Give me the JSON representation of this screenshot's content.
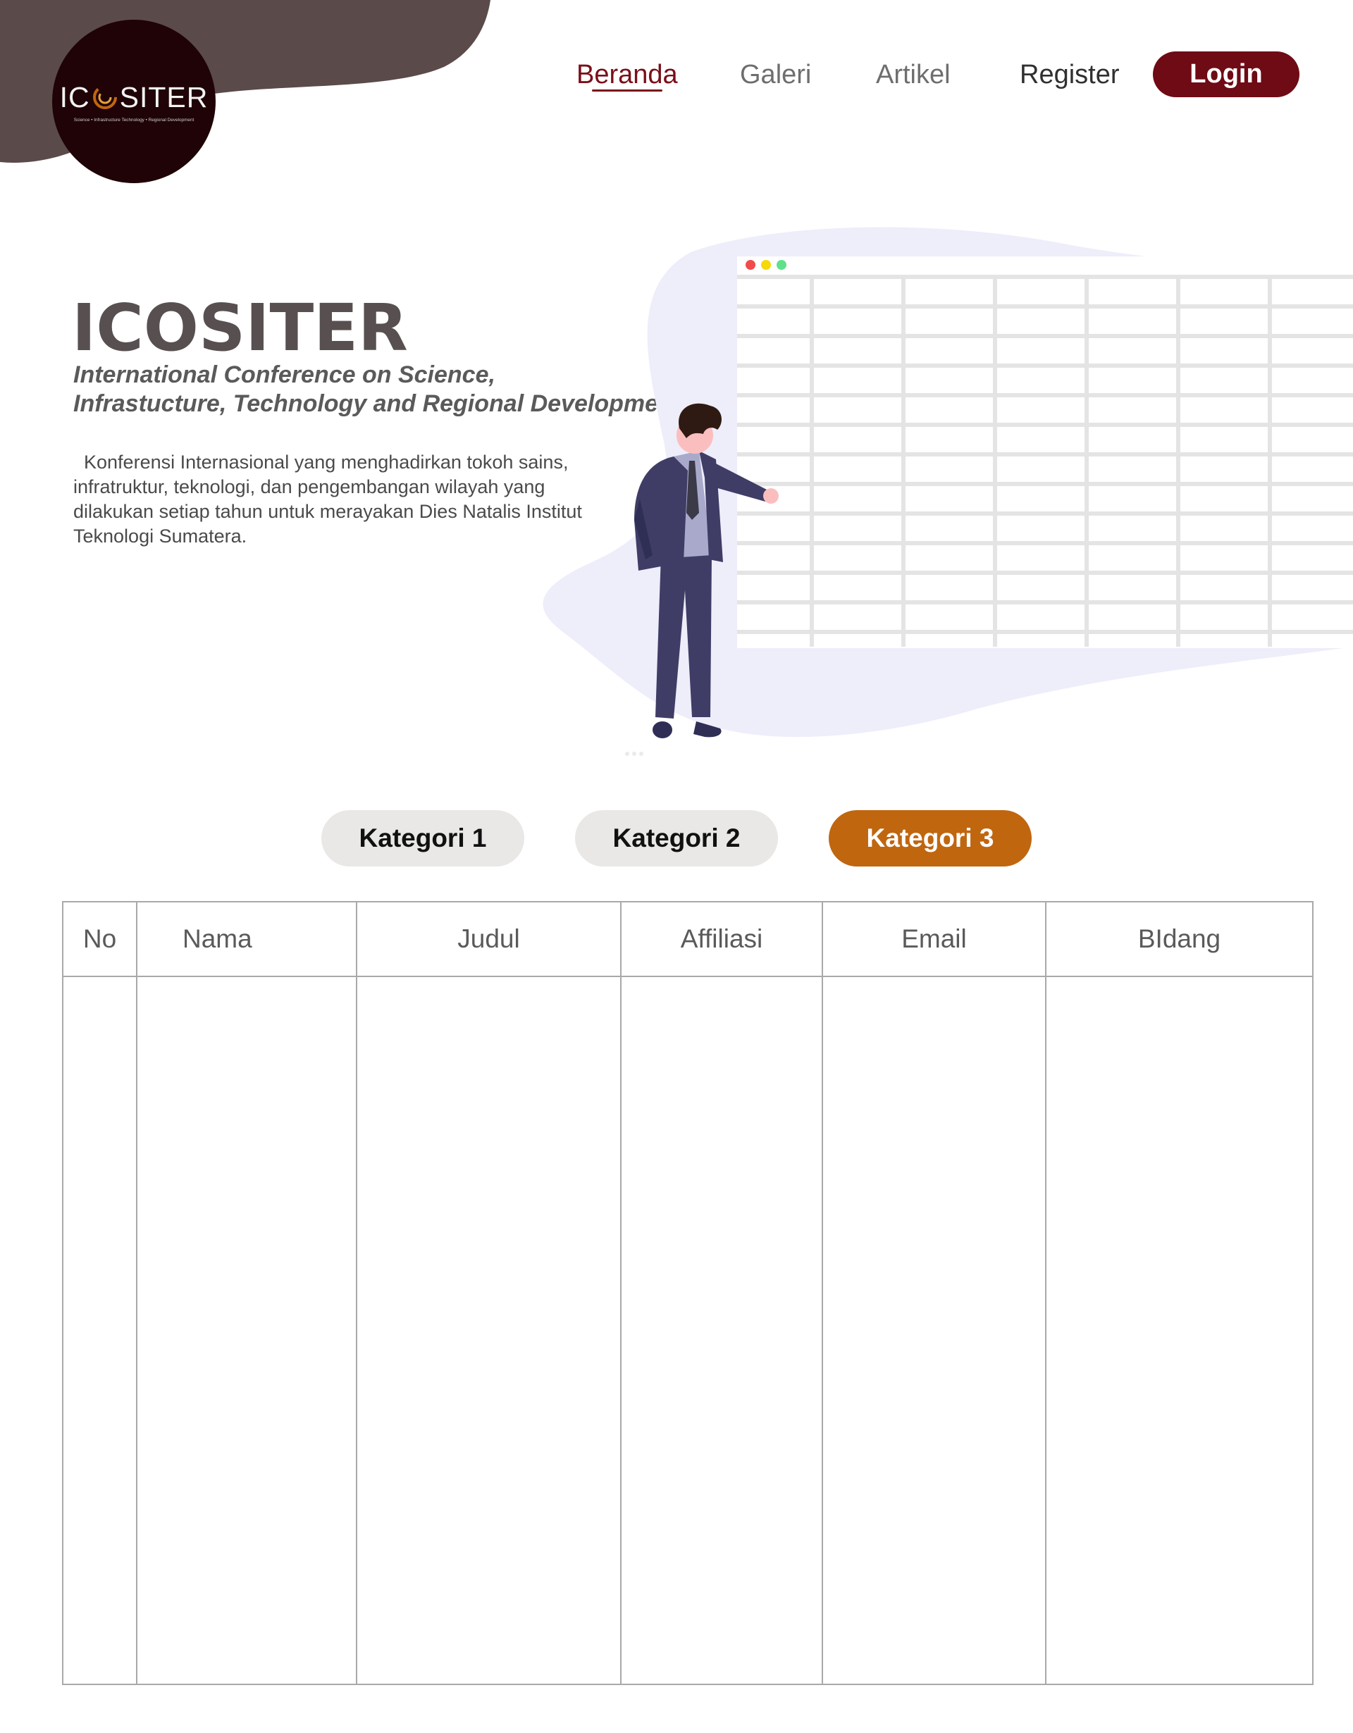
{
  "brand": {
    "logo_text_left": "IC",
    "logo_text_right": "SITER",
    "logo_tagline": "Science • Infrastructure Technology • Regional Development"
  },
  "nav": {
    "items": [
      {
        "label": "Beranda",
        "active": true
      },
      {
        "label": "Galeri",
        "active": false
      },
      {
        "label": "Artikel",
        "active": false
      },
      {
        "label": "Register",
        "active": false
      }
    ],
    "login_label": "Login"
  },
  "hero": {
    "title": "ICOSITER",
    "subtitle_line1": "International Conference on Science,",
    "subtitle_line2": "Infrastucture, Technology and Regional Development",
    "description": "  Konferensi Internasional yang menghadirkan tokoh sains, infratruktur, teknologi, dan pengembangan wilayah yang dilakukan setiap tahun untuk merayakan Dies Natalis Institut Teknologi Sumatera."
  },
  "tabs": [
    {
      "label": "Kategori 1",
      "active": false
    },
    {
      "label": "Kategori 2",
      "active": false
    },
    {
      "label": "Kategori 3",
      "active": true
    }
  ],
  "table": {
    "columns": [
      "No",
      "Nama",
      "Judul",
      "Affiliasi",
      "Email",
      "BIdang"
    ],
    "rows": []
  },
  "colors": {
    "brand_maroon": "#6e0b15",
    "accent_orange": "#c0660f",
    "blob_brown": "#5b4a4a",
    "logo_bg": "#1f0306"
  },
  "icons": {
    "logo_mark": "swirl-o-icon",
    "illustration": "presenter-spreadsheet-illustration"
  }
}
